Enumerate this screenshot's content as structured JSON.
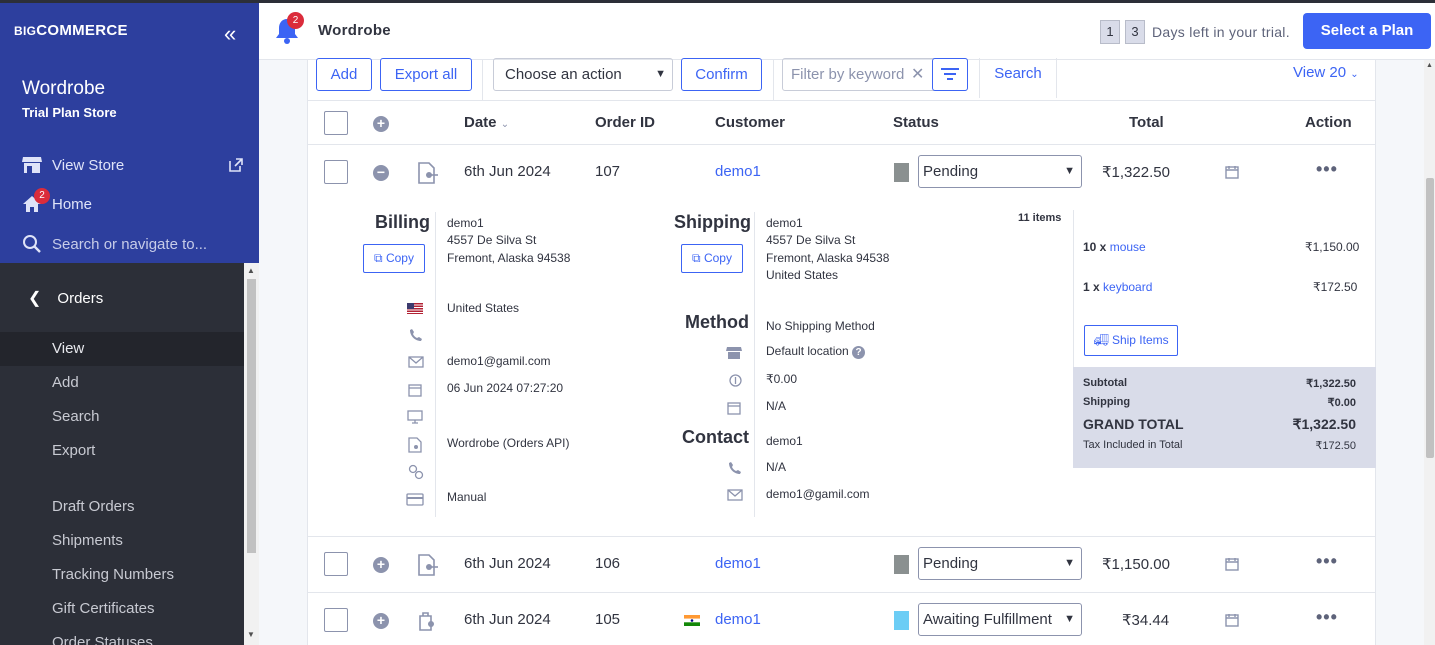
{
  "sidebar": {
    "logo_big": "BIG",
    "logo_rest": "COMMERCE",
    "store_name": "Wordrobe",
    "store_plan": "Trial Plan Store",
    "view_store": "View Store",
    "home": "Home",
    "home_badge": "2",
    "search_placeholder": "Search or navigate to...",
    "section": "Orders",
    "items": [
      {
        "label": "View"
      },
      {
        "label": "Add"
      },
      {
        "label": "Search"
      },
      {
        "label": "Export"
      },
      {
        "label": "Draft Orders"
      },
      {
        "label": "Shipments"
      },
      {
        "label": "Tracking Numbers"
      },
      {
        "label": "Gift Certificates"
      },
      {
        "label": "Order Statuses"
      }
    ]
  },
  "header": {
    "bell_badge": "2",
    "store_name": "Wordrobe",
    "trial_digits": [
      "1",
      "3"
    ],
    "trial_text": "Days left in your trial.",
    "plan_button": "Select a Plan"
  },
  "toolbar": {
    "add": "Add",
    "export_all": "Export all",
    "action_select": "Choose an action",
    "confirm": "Confirm",
    "filter_placeholder": "Filter by keyword",
    "search": "Search",
    "view": "View 20"
  },
  "table": {
    "headers": {
      "date": "Date",
      "order_id": "Order ID",
      "customer": "Customer",
      "status": "Status",
      "total": "Total",
      "action": "Action"
    },
    "rows": [
      {
        "date": "6th Jun 2024",
        "id": "107",
        "customer": "demo1",
        "status": "Pending",
        "status_color": "#8a9090",
        "total": "₹1,322.50"
      },
      {
        "date": "6th Jun 2024",
        "id": "106",
        "customer": "demo1",
        "status": "Pending",
        "status_color": "#8a9090",
        "total": "₹1,150.00"
      },
      {
        "date": "6th Jun 2024",
        "id": "105",
        "customer": "demo1",
        "status": "Awaiting Fulfillment",
        "status_color": "#6ccdf5",
        "total": "₹34.44"
      }
    ]
  },
  "details": {
    "billing": {
      "title": "Billing",
      "copy": "Copy",
      "name": "demo1",
      "street": "4557 De Silva St",
      "city": "Fremont, Alaska 94538",
      "country": "United States",
      "email": "demo1@gamil.com",
      "date": "06 Jun 2024 07:27:20",
      "source": "Wordrobe (Orders API)",
      "payment": "Manual"
    },
    "shipping": {
      "title": "Shipping",
      "copy": "Copy",
      "name": "demo1",
      "street": "4557 De Silva St",
      "city": "Fremont, Alaska 94538",
      "country": "United States",
      "items_count": "11 items",
      "method_title": "Method",
      "method": "No Shipping Method",
      "location": "Default location",
      "cost": "₹0.00",
      "date": "N/A",
      "contact_title": "Contact",
      "contact_name": "demo1",
      "contact_phone": "N/A",
      "contact_email": "demo1@gamil.com"
    },
    "items": [
      {
        "qty": "10 x",
        "name": "mouse",
        "price": "₹1,150.00"
      },
      {
        "qty": "1 x",
        "name": "keyboard",
        "price": "₹172.50"
      }
    ],
    "ship_items": "Ship Items",
    "summary": {
      "subtotal_label": "Subtotal",
      "subtotal": "₹1,322.50",
      "shipping_label": "Shipping",
      "shipping": "₹0.00",
      "grand_label": "GRAND TOTAL",
      "grand": "₹1,322.50",
      "tax_label": "Tax Included in Total",
      "tax": "₹172.50"
    }
  }
}
